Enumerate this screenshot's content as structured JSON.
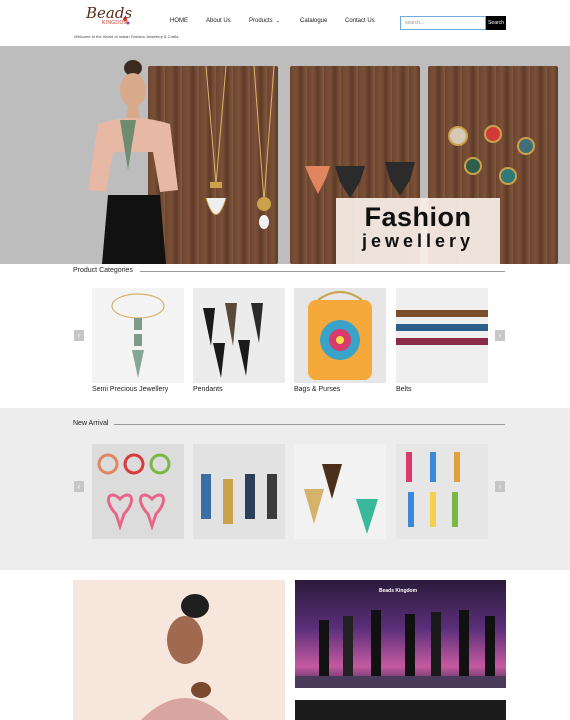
{
  "header": {
    "logo_text": "Beads",
    "logo_sub": "KINGDOM",
    "tagline": "Welcome to the World of Indian Fashion Jewellery & Crafts",
    "nav": [
      {
        "label": "HOME"
      },
      {
        "label": "About Us"
      },
      {
        "label": "Products"
      },
      {
        "label": "Catalogue"
      },
      {
        "label": "Contact Us"
      }
    ],
    "search_placeholder": "search...",
    "search_button": "Search"
  },
  "hero": {
    "title": "Fashion",
    "subtitle": "jewellery"
  },
  "product_categories": {
    "title": "Product Categories",
    "items": [
      {
        "label": "Semi Precious Jewellery"
      },
      {
        "label": "Pendants"
      },
      {
        "label": "Bags & Purses"
      },
      {
        "label": "Belts"
      }
    ]
  },
  "new_arrival": {
    "title": "New Arrival"
  },
  "bottom": {
    "stage_sign": "Beads Kingdom"
  },
  "colors": {
    "hero_bg": "#bdbdbd",
    "search_border": "#6fa8dc",
    "section_bg": "#ededed"
  }
}
